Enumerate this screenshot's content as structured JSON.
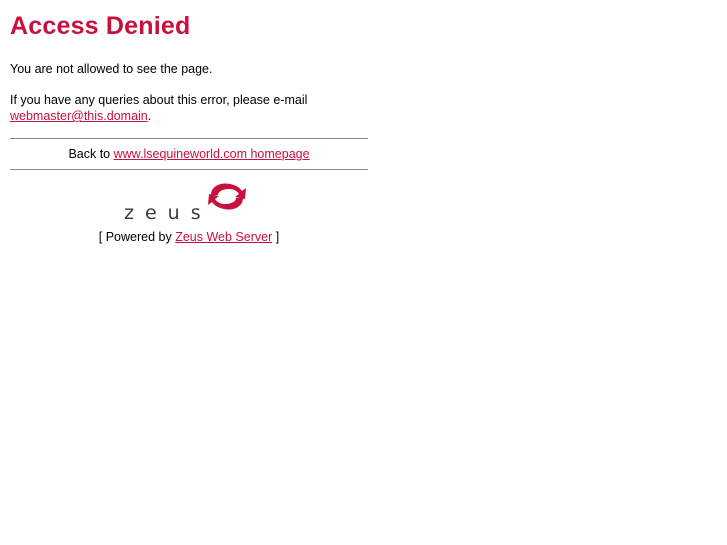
{
  "title": "Access Denied",
  "message": "You are not allowed to see the page.",
  "queries": {
    "text": "If you have any queries about this error, please e-mail",
    "email": "webmaster@this.domain",
    "suffix": "."
  },
  "back": {
    "prefix": "Back to",
    "link": "www.lsequineworld.com homepage"
  },
  "logo": {
    "wordmark": "zeus",
    "icon": "zeus-arrows-icon"
  },
  "powered": {
    "prefix": "[ Powered by",
    "link": "Zeus Web Server",
    "suffix": "]"
  },
  "colors": {
    "accent": "#c8103e",
    "rule": "#8a8a8a",
    "logo_text": "#3a3a3a"
  }
}
